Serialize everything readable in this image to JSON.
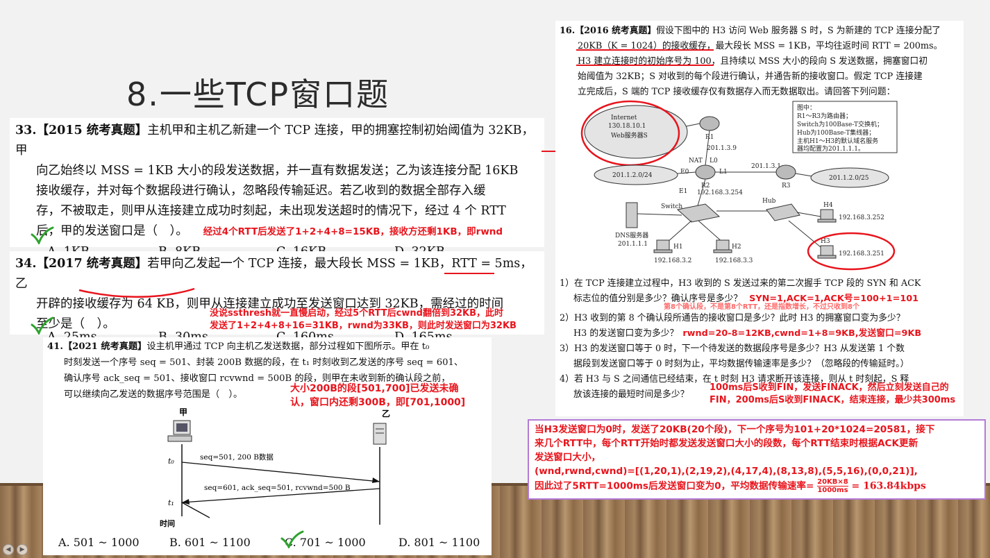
{
  "slide": {
    "title": "8.一些TCP窗口题"
  },
  "q33": {
    "number": "33.",
    "tag": "【2015 统考真题】",
    "lines": [
      "主机甲和主机乙新建一个 TCP 连接，甲的拥塞控制初始阈值为 32KB，甲",
      "向乙始终以 MSS = 1KB 大小的段发送数据，并一直有数据发送；乙为该连接分配 16KB",
      "接收缓存，并对每个数据段进行确认，忽略段传输延迟。若乙收到的数据全部存入缓",
      "存，不被取走，则甲从连接建立成功时刻起，未出现发送超时的情况下，经过 4 个 RTT",
      "后，甲的发送窗口是（　）。"
    ],
    "note": "经过4个RTT后发送了1+2+4+8=15KB，接收方还剩1KB，即rwnd",
    "options": [
      "A.  1KB",
      "B.  8KB",
      "C.  16KB",
      "D.  32KB"
    ]
  },
  "q34": {
    "number": "34.",
    "tag": "【2017 统考真题】",
    "lines": [
      "若甲向乙发起一个 TCP 连接，最大段长 MSS = 1KB，RTT = 5ms，乙",
      "开辟的接收缓存为 64 KB，则甲从连接建立成功至发送窗口达到 32KB，需经过的时间",
      "至少是（　）。"
    ],
    "note1": "没说ssthresh就一直慢启动，经过5个RTT后cwnd翻倍到32KB，此时",
    "note2": "发送了1+2+4+8+16=31KB，rwnd为33KB，则此时发送窗口为32KB",
    "options": [
      "A.  25ms",
      "B.  30ms",
      "C.  160ms",
      "D.  165ms"
    ]
  },
  "q41": {
    "number": "41.",
    "tag": "【2021 统考真题】",
    "lines": [
      "设主机甲通过 TCP 向主机乙发送数据，部分过程如下图所示。甲在 t₀",
      "时刻发送一个序号 seq = 501、封装 200B 数据的段，在 t₁ 时刻收到乙发送的序号 seq = 601、",
      "确认序号 ack_seq = 501、接收窗口 rcvwnd = 500B 的段，则甲在未收到新的确认段之前，",
      "可以继续向乙发送的数据序号范围是（　）。"
    ],
    "note1": "大小200B的段[501,700]已发送未确",
    "note2": "认，窗口内还剩300B，即[701,1000]",
    "host_a": "甲",
    "host_b": "乙",
    "t0": "t₀",
    "t1": "t₁",
    "time_label": "时间",
    "arrow1": "seq=501, 200 B数据",
    "arrow2": "seq=601, ack_seq=501, rcvwnd=500 B",
    "options": [
      "A.  501 ~ 1000",
      "B.  601 ~ 1100",
      "C.  701 ~ 1000",
      "D.  801 ~ 1100"
    ]
  },
  "q16": {
    "number": "16.",
    "tag": "【2016 统考真题】",
    "lines": [
      "假设下图中的 H3 访问 Web 服务器 S 时，S 为新建的 TCP 连接分配了",
      "20KB（K = 1024）的接收缓存，最大段长 MSS = 1KB，平均往返时间 RTT = 200ms。",
      "H3 建立连接时的初始序号为 100，且持续以 MSS 大小的段向 S 发送数据，拥塞窗口初",
      "始阈值为 32KB；S 对收到的每个段进行确认，并通告新的接收窗口。假定 TCP 连接建",
      "立完成后，S 端的 TCP 接收缓存仅有数据存入而无数据取出。请回答下列问题："
    ],
    "diagram": {
      "internet_l1": "Internet",
      "internet_l2": "130.18.10.1",
      "internet_l3": "Web服务器S",
      "r1": "R1",
      "r2": "R2",
      "r3": "R3",
      "nat": "NAT",
      "l0": "L0",
      "l1": "L1",
      "e0": "E0",
      "e1": "E1",
      "ip_r1": "201.1.3.9",
      "ip_r3": "201.1.3.1",
      "net_left": "201.1.2.0/24",
      "net_right": "201.1.2.0/25",
      "ip_e1": "192.168.3.254",
      "switch": "Switch",
      "hub": "Hub",
      "dns": "DNS服务器",
      "dns_ip": "201.1.1.1",
      "h1": "H1",
      "h1_ip": "192.168.3.2",
      "h2": "H2",
      "h2_ip": "192.168.3.3",
      "h3": "H3",
      "h3_ip": "192.168.3.251",
      "h4": "H4",
      "h4_ip": "192.168.3.252",
      "legend": [
        "图中：",
        "R1～R3为路由器；",
        "Switch为100Base-T交换机；",
        "Hub为100Base-T集线器；",
        "主机H1～H3的默认域名服务",
        "器均配置为201.1.1.1。"
      ]
    },
    "q1a": "1）在 TCP 连接建立过程中，H3 收到的 S 发送过来的第二次握手 TCP 段的 SYN 和 ACK",
    "q1b": "标志位的值分别是多少？确认序号是多少？",
    "q1ans": "SYN=1,ACK=1,ACK号=100+1=101",
    "q2note": "第8个确认段，不是第8个RTT，还是指数增长，不过只收到8个",
    "q2a": "2）H3 收到的第 8 个确认段所通告的接收窗口是多少？此时 H3 的拥塞窗口变为多少？",
    "q2b": "H3 的发送窗口变为多少？",
    "q2ans": "rwnd=20-8=12KB,cwnd=1+8=9KB,发送窗口=9KB",
    "q3a": "3）H3 的发送窗口等于 0 时，下一个待发送的数据段序号是多少？H3 从发送第 1 个数",
    "q3b": "据段到发送窗口等于 0 时刻为止，平均数据传输速率是多少？（忽略段的传输延时。）",
    "q4a": "4）若 H3 与 S 之间通信已经结束，在 t 时刻 H3 请求断开该连接，则从 t 时刻起，S 释",
    "q4b": "放该连接的最短时间是多少？",
    "q4ans1": "100ms后S收到FIN，发送FINACK，然后立刻发送自己的",
    "q4ans2": "FIN，200ms后S收到FINACK，结束连接，最少共300ms"
  },
  "purple_box": {
    "line1": "当H3发送窗口为0时，发送了20KB(20个段)，下一个序号为101+20*1024=20581，接下",
    "line2": "来几个RTT中，每个RTT开始时都发送发送窗口大小的段数，每个RTT结束时根据ACK更新",
    "line3": "发送窗口大小，",
    "line4": "(wnd,rwnd,cwnd)=[(1,20,1),(2,19,2),(4,17,4),(8,13,8),(5,5,16),(0,0,21)],",
    "line5a": "因此过了5RTT=1000ms后发送窗口变为0，平均数据传输速率=",
    "frac_num": "20KB×8",
    "frac_den": "1000ms",
    "line5b": "= 163.84kbps"
  },
  "nav": {
    "prev": "◀",
    "next": "▶"
  }
}
